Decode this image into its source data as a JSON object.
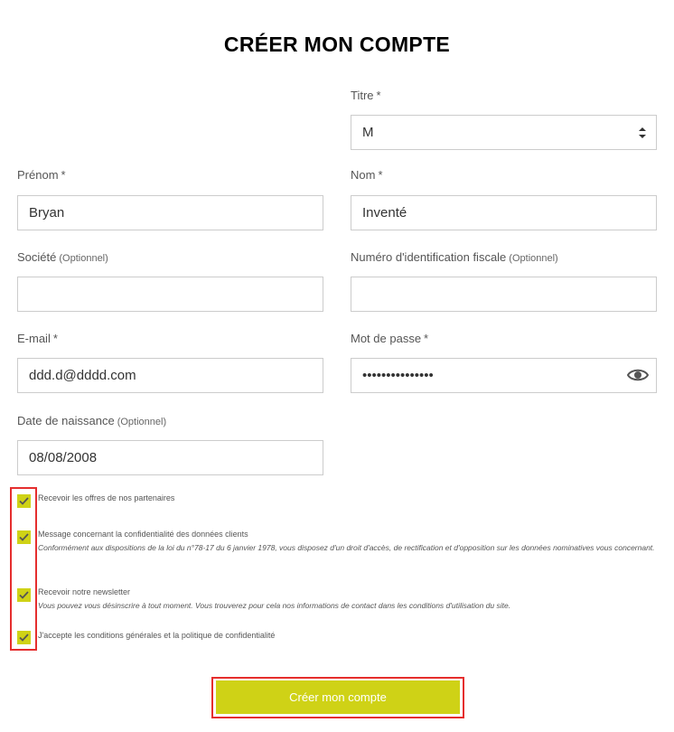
{
  "form": {
    "title": "CRÉER MON COMPTE",
    "required_mark": "*",
    "optional_label": "(Optionnel)",
    "titre": {
      "label": "Titre",
      "value": "M"
    },
    "prenom": {
      "label": "Prénom",
      "value": "Bryan"
    },
    "nom": {
      "label": "Nom",
      "value": "Inventé"
    },
    "societe": {
      "label": "Société",
      "value": ""
    },
    "fiscal": {
      "label": "Numéro d'identification fiscale",
      "value": ""
    },
    "email": {
      "label": "E-mail",
      "value": "ddd.d@dddd.com"
    },
    "password": {
      "label": "Mot de passe",
      "value": "•••••••••••••••"
    },
    "birthdate": {
      "label": "Date de naissance",
      "value": "08/08/2008"
    }
  },
  "checkboxes": [
    {
      "label": "Recevoir les offres de nos partenaires",
      "checked": true
    },
    {
      "label": "Message concernant la confidentialité des données clients",
      "checked": true,
      "desc": "Conformément aux dispositions de la loi du n°78-17 du 6 janvier 1978, vous disposez d'un droit d'accès, de rectification et d'opposition sur les données nominatives vous concernant."
    },
    {
      "label": "Recevoir notre newsletter",
      "checked": true,
      "desc": "Vous pouvez vous désinscrire à tout moment. Vous trouverez pour cela nos informations de contact dans les conditions d'utilisation du site."
    },
    {
      "label": "J'accepte les conditions générales et la politique de confidentialité",
      "checked": true
    }
  ],
  "submit_label": "Créer mon compte",
  "colors": {
    "accent": "#cfd216",
    "highlight": "#e52e2e",
    "text": "#333333",
    "border": "#cccccc"
  },
  "icons": {
    "select": "chevron-up-down-icon",
    "password_toggle": "eye-icon",
    "checkbox": "checkmark-icon"
  }
}
